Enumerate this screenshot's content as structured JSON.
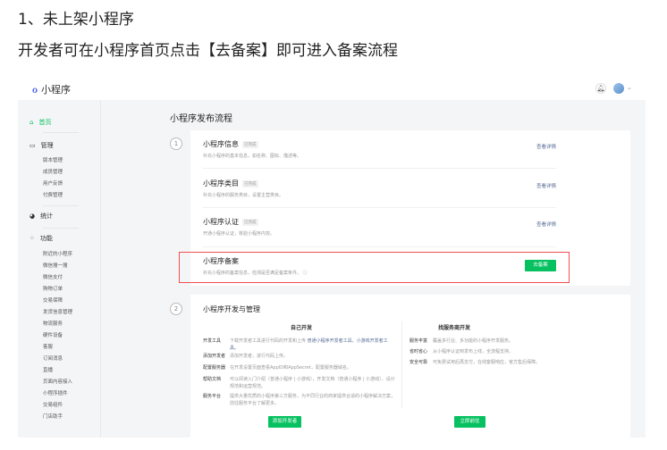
{
  "heading": "1、未上架小程序",
  "instruction": "开发者可在小程序首页点击【去备案】即可进入备案流程",
  "app": {
    "logo_text": "小程序",
    "bell_icon": "bell-icon",
    "avatar": "user-avatar"
  },
  "sidebar": {
    "home": "首页",
    "manage": "管理",
    "manage_items": [
      "版本管理",
      "成员管理",
      "用户反馈",
      "付费管理"
    ],
    "stats": "统计",
    "features": "功能",
    "feature_items": [
      "附近的小程序",
      "微信搜一搜",
      "微信支付",
      "购物订单",
      "交易保障",
      "发货信息管理",
      "物流服务",
      "硬件设备",
      "客服",
      "订阅消息",
      "直播",
      "页面内容接入",
      "小程序插件",
      "交易组件",
      "门店助手"
    ]
  },
  "main": {
    "title": "小程序发布流程",
    "step1": "1",
    "step2": "2",
    "flow": [
      {
        "title": "小程序信息",
        "tag": "已完成",
        "desc": "补充小程序的基本信息，如名称、图标、描述等。",
        "link": "查看详情"
      },
      {
        "title": "小程序类目",
        "tag": "已完成",
        "desc": "补充小程序的服务类目，设置主营类目。",
        "link": "查看详情"
      },
      {
        "title": "小程序认证",
        "tag": "已完成",
        "desc": "开通小程序认证，核验小程序内容。",
        "link": "查看详情"
      },
      {
        "title": "小程序备案",
        "desc": "补充小程序的备案信息，检测是否满足备案条件。 ⓘ",
        "button": "去备案"
      }
    ],
    "dev": {
      "title": "小程序开发与管理",
      "self": {
        "heading": "自己开发",
        "rows": [
          {
            "k": "开发工具",
            "v": "下载开发者工具进行代码的开发和上传 ",
            "link": "普通小程序开发者工具、小游戏开发者工具。"
          },
          {
            "k": "添加开发者",
            "v": "添加开发者，进行代码上传。"
          },
          {
            "k": "配置服务器",
            "v": "在开发设置页面查看AppID和AppSecret，配置服务器域名。"
          },
          {
            "k": "帮助文档",
            "v": "可以阅读入门介绍（普通小程序 | 小游戏），开发文档（普通小程序 | 小游戏）、设计规范和运营规范。"
          },
          {
            "k": "服务平台",
            "v": "提供大量优质的小程序第三方服务，为不同行业的商家提供合适的小程序解决方案，前往服务平台了解更多。"
          }
        ],
        "button": "添加开发者"
      },
      "vendor": {
        "heading": "找服务商开发",
        "rows": [
          {
            "k": "服务丰富",
            "v": "覆盖多行业、多功能的小程序开发服务。"
          },
          {
            "k": "省时省心",
            "v": "从小程序认证到发布上线，全流程支持。"
          },
          {
            "k": "安全可靠",
            "v": "可免费试用后再支付，在线客服响应，官方售后保障。"
          }
        ],
        "button": "立即前往"
      }
    }
  },
  "colors": {
    "accent": "#07c160",
    "highlight": "#f05050",
    "link": "#576b95"
  }
}
